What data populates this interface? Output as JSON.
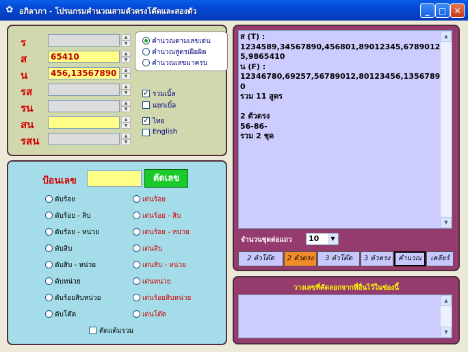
{
  "window": {
    "title": "อภิลาภา - โปรแกรมคำนวณสามตัวตรงโต๊ดและสองตัว",
    "icon": "rabbit-icon",
    "min": "_",
    "max": "□",
    "close": "✕"
  },
  "fields": [
    {
      "label": "ร",
      "value": ""
    },
    {
      "label": "ส",
      "value": "65410"
    },
    {
      "label": "น",
      "value": "456,13567890"
    },
    {
      "label": "รส",
      "value": ""
    },
    {
      "label": "รน",
      "value": ""
    },
    {
      "label": "สน",
      "value": ""
    },
    {
      "label": "รสน",
      "value": ""
    }
  ],
  "calc_modes": [
    "คำนวณตามเลขเด่น",
    "คำนวณสูตรเฝือผิด",
    "คำนวณเลขมาครบ"
  ],
  "checks": {
    "combine": "รวมเบิ้ล",
    "separate": "แยกเบิ้ล",
    "thai": "ไทย",
    "english": "English"
  },
  "input": {
    "label": "ป้อนเลข",
    "value": "",
    "cut_button": "ตัดเลข"
  },
  "options_left": [
    "ดับร้อย",
    "ดับร้อย - สิบ",
    "ดับร้อย - หน่วย",
    "ดับสิบ",
    "ดับสิบ - หน่วย",
    "ดับหน่วย",
    "ดับร้อยสิบหน่วย",
    "ดับโต๊ด"
  ],
  "options_right": [
    "เด่นร้อย",
    "เด่นร้อย - สิบ",
    "เด่นร้อย - หน่วย",
    "เด่นสิบ",
    "เด่นสิบ - หน่วย",
    "เด่นหน่วย",
    "เด่นร้อยสิบหน่วย",
    "เด่นโต๊ด"
  ],
  "cut_wrap": "ตัดแต้มรวม",
  "output": {
    "text": "ส (T) :\n1234589,34567890,456801,89012345,67890125,9865410\nน (F) :\n12346780,69257,56789012,80123456,13567890\nรวม 11 สูตร\n\n2 ตัวตรง\n56-86-\nรวม 2 ชุด"
  },
  "sets_per_row": {
    "label": "จำนวนชุดต่อแถว",
    "value": "10"
  },
  "buttons": [
    "2 ตัวโต๊ด",
    "2 ตัวตรง",
    "3 ตัวโต๊ด",
    "3 ตัวตรง",
    "คำนวณ",
    "เคลียร์"
  ],
  "paste_label": "วางเลขที่คัดลอกจากที่อื่นไว้ในช่องนี้",
  "colors": {
    "active_button": "#f28c28",
    "panel_top": "#d1d8ad",
    "panel_bottom": "#a4dde9",
    "panel_right": "#953b6e"
  }
}
